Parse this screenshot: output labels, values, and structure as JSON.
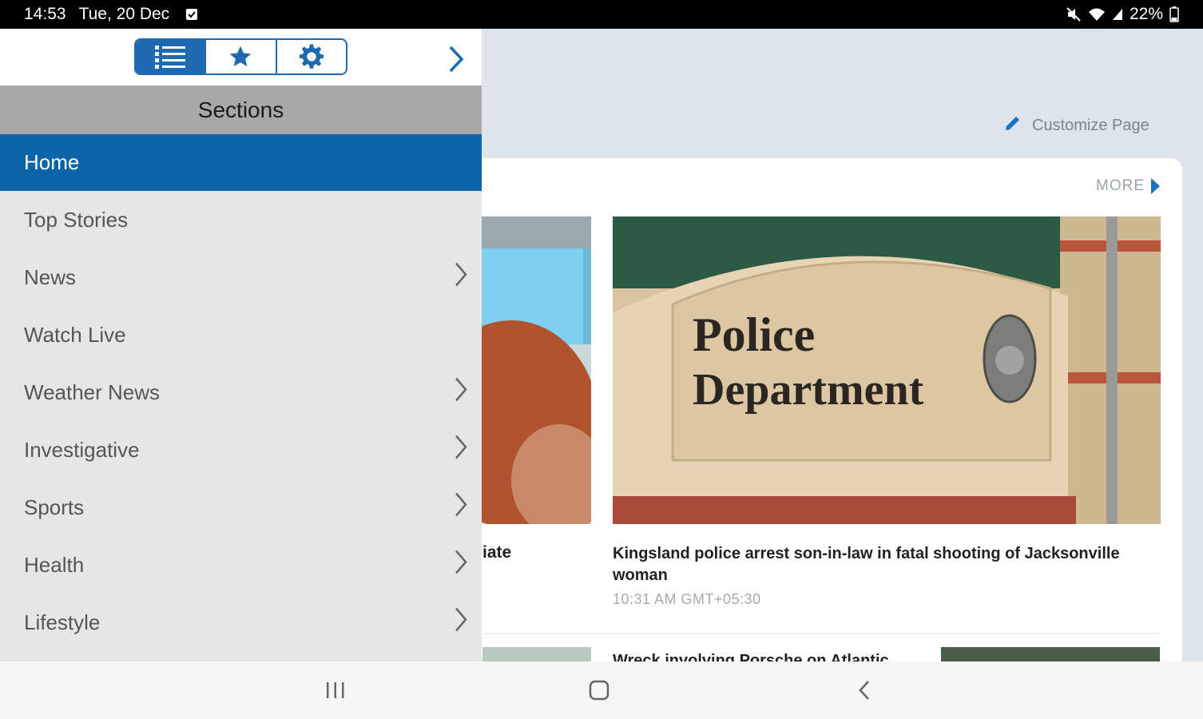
{
  "status_bar": {
    "time": "14:53",
    "date": "Tue, 20 Dec",
    "battery": "22%"
  },
  "drawer": {
    "tabs": [
      {
        "icon": "list-icon",
        "active": true
      },
      {
        "icon": "star-icon",
        "active": false
      },
      {
        "icon": "gear-icon",
        "active": false
      }
    ],
    "header": "Sections",
    "items": [
      {
        "label": "Home",
        "active": true,
        "has_submenu": false
      },
      {
        "label": "Top Stories",
        "active": false,
        "has_submenu": false
      },
      {
        "label": "News",
        "active": false,
        "has_submenu": true
      },
      {
        "label": "Watch Live",
        "active": false,
        "has_submenu": false
      },
      {
        "label": "Weather News",
        "active": false,
        "has_submenu": true
      },
      {
        "label": "Investigative",
        "active": false,
        "has_submenu": true
      },
      {
        "label": "Sports",
        "active": false,
        "has_submenu": true
      },
      {
        "label": "Health",
        "active": false,
        "has_submenu": true
      },
      {
        "label": "Lifestyle",
        "active": false,
        "has_submenu": true
      }
    ]
  },
  "main": {
    "customize_label": "Customize Page",
    "more_label": "MORE",
    "left_headline_fragment": "iate",
    "featured": {
      "sign_line1": "Police",
      "sign_line2": "Department",
      "headline": "Kingsland police arrest son-in-law in fatal shooting of Jacksonville woman",
      "timestamp": "10:31 AM GMT+05:30"
    },
    "second_headline": "Wreck involving Porsche on Atlantic"
  },
  "colors": {
    "accent": "#0b64a8",
    "drawer_bg": "#e6e6e6",
    "sections_header_bg": "#a8a8a8"
  }
}
